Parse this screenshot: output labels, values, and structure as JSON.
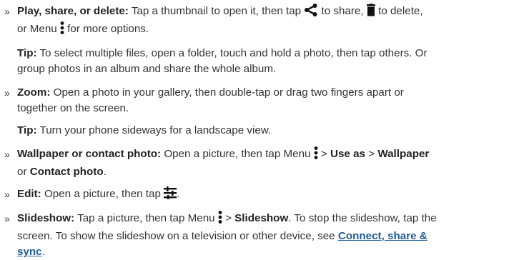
{
  "bullet_glyph": "»",
  "items": {
    "play": {
      "title": "Play, share, or delete:",
      "t1": " Tap a thumbnail to open it, then tap ",
      "t2": " to share, ",
      "t3": " to delete,",
      "t4": "or Menu ",
      "t5": " for more options."
    },
    "tip1": {
      "label": "Tip:",
      "line1": " To select multiple files, open a folder, touch and hold a photo, then tap others. Or",
      "line2": "group photos in an album and share the whole album."
    },
    "zoom": {
      "title": "Zoom:",
      "line1": " Open a photo in your gallery, then double-tap or drag two fingers apart or",
      "line2": "together on the screen."
    },
    "tip2": {
      "label": "Tip:",
      "text": " Turn your phone sideways for a landscape view."
    },
    "wallpaper": {
      "title": "Wallpaper or contact photo:",
      "t1": " Open a picture, then tap Menu ",
      "t2": " > ",
      "use_as": "Use as",
      "t3": " > ",
      "wallpaper": "Wallpaper",
      "t4": "or ",
      "contact": "Contact photo",
      "t5": "."
    },
    "edit": {
      "title": "Edit:",
      "t1": " Open a picture, then tap ",
      "t2": "."
    },
    "slideshow": {
      "title": "Slideshow:",
      "t1": " Tap a picture, then tap Menu ",
      "t2": " > ",
      "slideshow": "Slideshow",
      "t3": ". To stop the slideshow, tap the",
      "line2": "screen. To show the slideshow on a television or other device, see ",
      "link_a": "Connect, share &",
      "link_b": "sync",
      "t4": "."
    }
  },
  "icons": {
    "share": "share-icon",
    "delete": "trash-icon",
    "menu": "menu-dots-icon",
    "edit": "tune-sliders-icon"
  },
  "colors": {
    "text": "#333333",
    "link": "#1f5c99"
  }
}
